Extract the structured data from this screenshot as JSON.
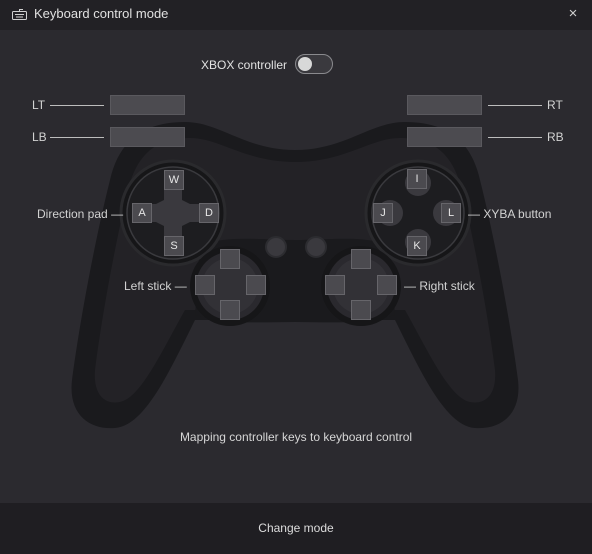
{
  "window": {
    "title": "Keyboard control mode",
    "icon": "keyboard-icon",
    "close_label": "×"
  },
  "toggle": {
    "label": "XBOX controller",
    "on": false
  },
  "labels": {
    "lt": "LT",
    "lb": "LB",
    "rt": "RT",
    "rb": "RB",
    "direction_pad": "Direction pad",
    "xyba": "XYBA button",
    "left_stick": "Left stick",
    "right_stick": "Right stick",
    "dash": "—"
  },
  "bindings": {
    "lt": "",
    "lb": "",
    "rt": "",
    "rb": ""
  },
  "dpad": {
    "up": "W",
    "left": "A",
    "right": "D",
    "down": "S"
  },
  "xyba": {
    "up": "I",
    "left": "J",
    "right": "L",
    "down": "K"
  },
  "left_stick": {
    "up": "",
    "left": "",
    "right": "",
    "down": ""
  },
  "right_stick": {
    "up": "",
    "left": "",
    "right": "",
    "down": ""
  },
  "mapping_text": "Mapping controller keys to keyboard control",
  "footer": {
    "change_mode": "Change mode"
  },
  "colors": {
    "window_bg": "#2b2a2f",
    "titlebar_bg": "#222125",
    "footer_bg": "#1f1e22",
    "controller": "#1a1a1d"
  }
}
